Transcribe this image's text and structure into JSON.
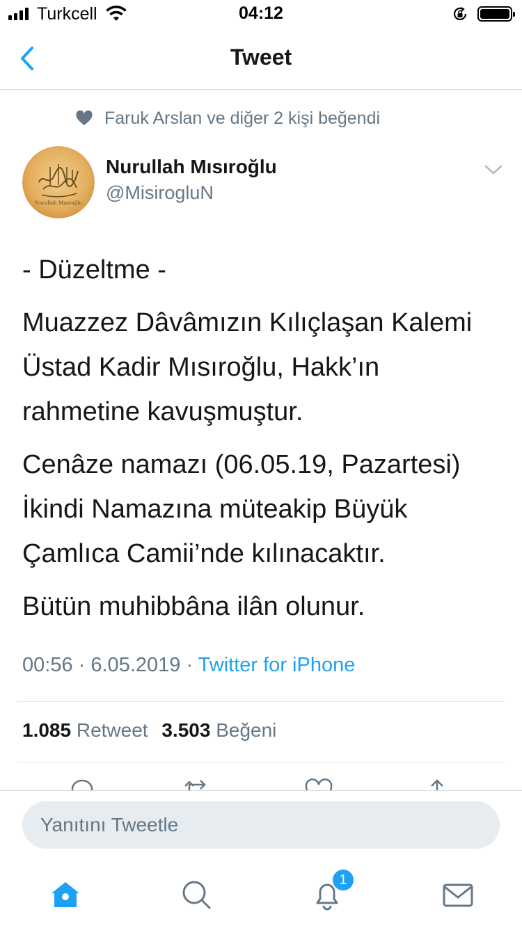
{
  "status_bar": {
    "carrier": "Turkcell",
    "time": "04:12"
  },
  "nav": {
    "title": "Tweet"
  },
  "social_context": {
    "text": "Faruk Arslan ve diğer 2 kişi beğendi"
  },
  "author": {
    "name": "Nurullah Mısıroğlu",
    "handle": "@MisirogluN",
    "avatar_caption": "Nurullah Mısıroğlu"
  },
  "tweet": {
    "paragraphs": [
      "- Düzeltme -",
      "Muazzez Dâvâmızın Kılıçlaşan Kalemi Üstad Kadir Mısıroğlu, Hakk’ın rahmetine kavuşmuştur.",
      "Cenâze namazı (06.05.19, Pazartesi) İkindi Namazına müteakip Büyük Çamlıca Camii’nde kılınacaktır.",
      "Bütün muhibbâna ilân olunur."
    ],
    "time": "00:56",
    "date": "6.05.2019",
    "separator": "·",
    "source": "Twitter for iPhone"
  },
  "stats": {
    "retweet_count": "1.085",
    "retweet_label": "Retweet",
    "like_count": "3.503",
    "like_label": "Beğeni"
  },
  "reply": {
    "placeholder": "Yanıtını Tweetle"
  },
  "tab_bar": {
    "notifications_badge": "1"
  },
  "colors": {
    "accent": "#1da1f2",
    "text_primary": "#14171a",
    "text_secondary": "#657786",
    "divider": "#e1e8ed",
    "input_bg": "#e6ecf0"
  },
  "icons": {
    "back": "chevron-left-icon",
    "like_context": "heart-icon",
    "caret": "chevron-down-icon",
    "reply": "reply-icon",
    "retweet": "retweet-icon",
    "like": "heart-outline-icon",
    "share": "share-icon",
    "home": "home-icon",
    "search": "search-icon",
    "notifications": "bell-icon",
    "messages": "mail-icon"
  }
}
